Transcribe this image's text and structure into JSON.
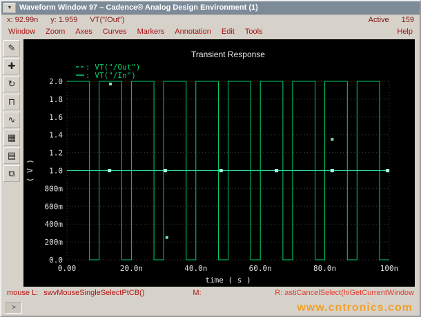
{
  "window": {
    "title": "Waveform Window 97 – Cadence® Analog Design Environment (1)",
    "menu_button_glyph": "▼"
  },
  "infobar": {
    "x": "x: 92.99n",
    "y": "y: 1.959",
    "trace": "VT(\"/Out\")",
    "active_label": "Active",
    "active_count": "159"
  },
  "menubar": {
    "items": [
      "Window",
      "Zoom",
      "Axes",
      "Curves",
      "Markers",
      "Annotation",
      "Edit",
      "Tools"
    ],
    "help": "Help"
  },
  "toolbar": {
    "icons": [
      {
        "name": "probe-pencil-icon",
        "glyph": "✎"
      },
      {
        "name": "zoom-fit-icon",
        "glyph": "✚"
      },
      {
        "name": "redraw-rotate-icon",
        "glyph": "↻"
      },
      {
        "name": "strip-chart-icon",
        "glyph": "⊓"
      },
      {
        "name": "waveform-icon",
        "glyph": "∿"
      },
      {
        "name": "grid-table-icon",
        "glyph": "▦"
      },
      {
        "name": "layers-icon",
        "glyph": "▤"
      },
      {
        "name": "subwindow-icon",
        "glyph": "⧉"
      }
    ]
  },
  "plot": {
    "title": "Transient Response",
    "ylabel": "( V )",
    "xlabel": "time ( s )",
    "yticks": [
      "2.0",
      "1.8",
      "1.6",
      "1.4",
      "1.2",
      "1.0",
      "800m",
      "600m",
      "400m",
      "200m",
      "0.0"
    ],
    "xticks": [
      "0.00",
      "20.0n",
      "40.0n",
      "60.0n",
      "80.0n",
      "100n"
    ],
    "legend": [
      {
        "label": ": VT(\"/Out\")",
        "color": "#00d26a",
        "style": "dashed"
      },
      {
        "label": ": VT(\"/In\")",
        "color": "#00d26a",
        "style": "solid"
      }
    ]
  },
  "statusbar": {
    "mouse_l": "mouse L:",
    "mouse_l_cmd": "swvMouseSingleSelectPtCB()",
    "mouse_m": "M:",
    "right": "R: astiCancelSelect(hiGetCurrentWindow",
    "prompt": ">"
  },
  "watermark": "www.cntronics.com",
  "chart_data": {
    "type": "line",
    "title": "Transient Response",
    "xlabel": "time ( s )",
    "ylabel": "( V )",
    "xlim_ns": [
      0,
      100
    ],
    "ylim_v": [
      0.0,
      2.0
    ],
    "x_tick_step_ns": 20,
    "y_tick_step_v": 0.2,
    "grid": true,
    "legend_position": "top-left",
    "series": [
      {
        "name": "VT(\"/Out\")",
        "waveform": "square",
        "period_ns": 10,
        "high_ns": 7,
        "high_v": 2.0,
        "low_v": 0.0,
        "starts": "high",
        "color": "#00d26a"
      },
      {
        "name": "VT(\"/In\")",
        "waveform": "dc",
        "level_v": 1.0,
        "color": "#2bd6a4",
        "marker_ts_ns": [
          13.2,
          30.5,
          47.8,
          65.0,
          82.3,
          99.5
        ],
        "marker_color": "#a8f5dd"
      }
    ],
    "stray_points": [
      {
        "t_ns": 82.3,
        "v": 1.35
      },
      {
        "t_ns": 31.0,
        "v": 0.25
      },
      {
        "t_ns": 13.5,
        "v": 1.97
      }
    ]
  }
}
